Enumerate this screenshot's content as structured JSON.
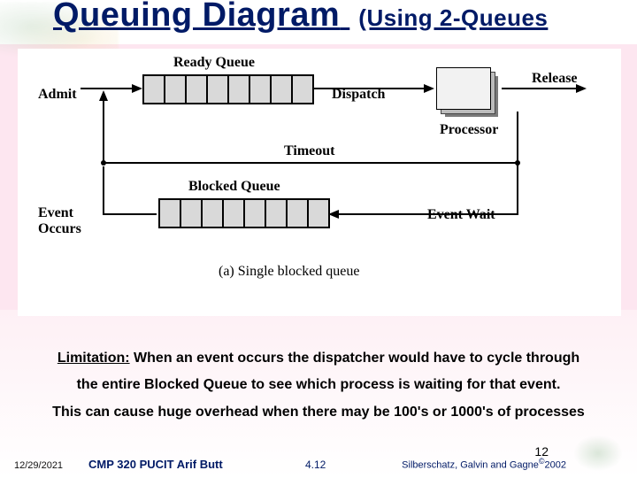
{
  "title": {
    "main": "Queuing Diagram",
    "sub": "(Using 2-Queues"
  },
  "diagram": {
    "admit": "Admit",
    "ready_queue": "Ready Queue",
    "dispatch": "Dispatch",
    "processor": "Processor",
    "release": "Release",
    "timeout": "Timeout",
    "blocked_queue": "Blocked Queue",
    "event_wait": "Event Wait",
    "event_occurs": "Event\nOccurs",
    "caption": "(a) Single blocked queue"
  },
  "body": {
    "limitation_label": "Limitation:",
    "line1": " When an event occurs the dispatcher would have to cycle through",
    "line2": "the entire Blocked Queue to see which process is waiting for that event.",
    "line3": "This can cause huge overhead when there may be 100's or 1000's of processes"
  },
  "footer": {
    "date": "12/29/2021",
    "course": "CMP 320   PUCIT   Arif Butt",
    "page": "4.12",
    "credits_pre": "Silberschatz, Galvin and Gagne",
    "credits_post": "2002",
    "slide_number": "12"
  }
}
